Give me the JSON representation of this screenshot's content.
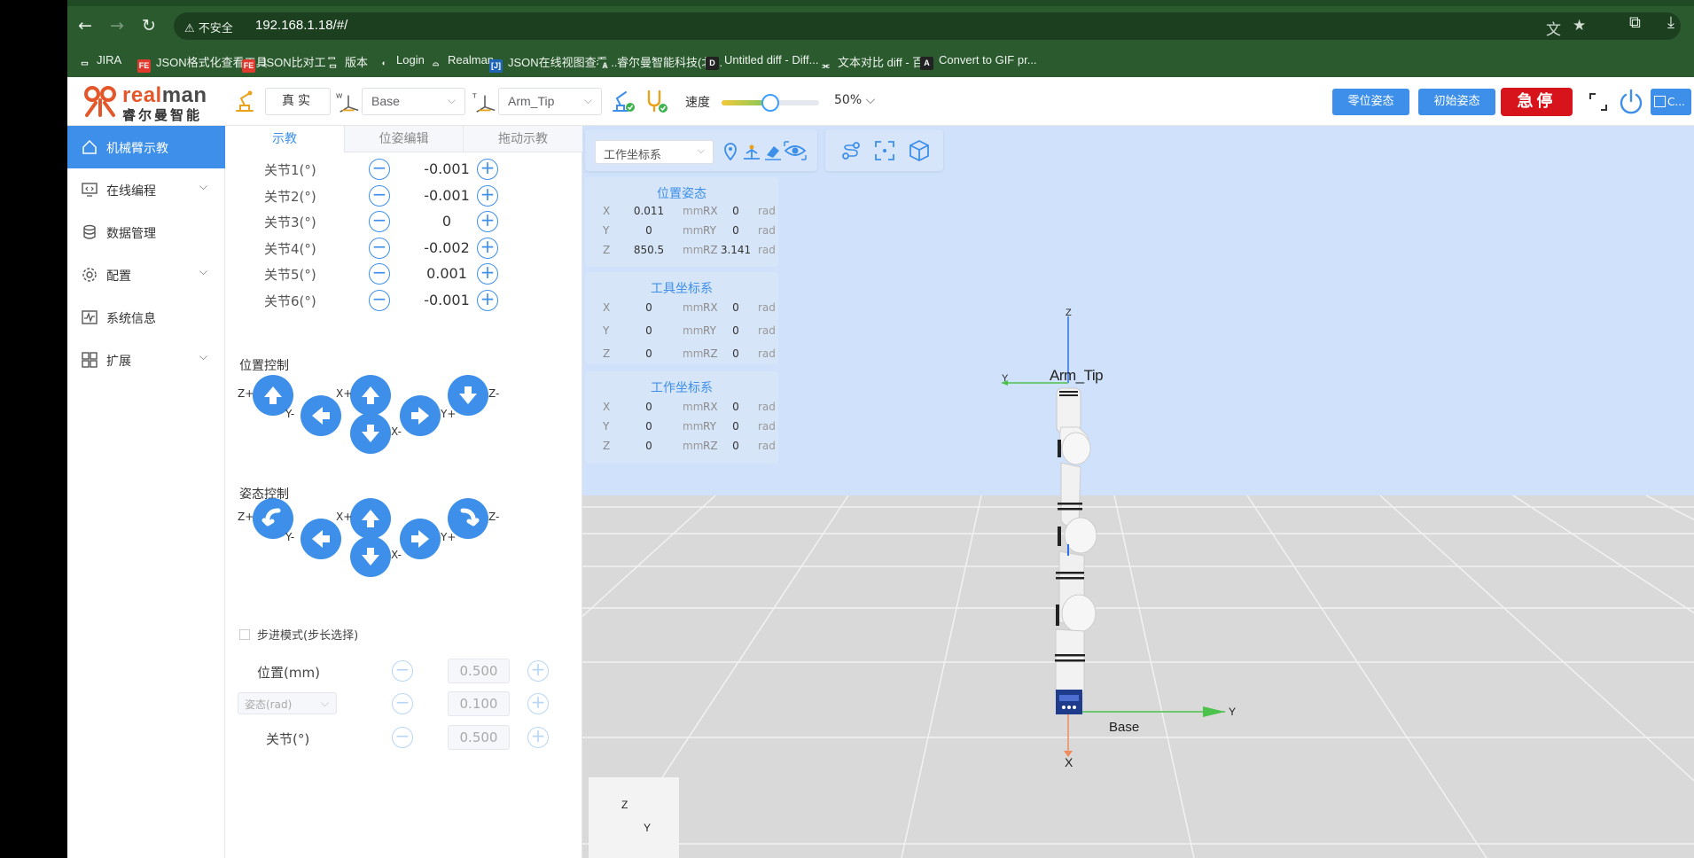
{
  "browser": {
    "security_label": "不安全",
    "url": "192.168.1.18/#/",
    "bookmarks": [
      "JIRA",
      "JSON格式化查看工具",
      "JSON比对工具",
      "版本",
      "Login",
      "Realman",
      "JSON在线视图查看...",
      "睿尔曼智能科技(北...",
      "Untitled diff - Diff...",
      "文本对比 diff - 百...",
      "Convert to GIF pr..."
    ]
  },
  "logo": {
    "en_prefix": "real",
    "en_suffix": "man",
    "cn": "睿尔曼智能"
  },
  "topbar": {
    "mode_button": "真实",
    "frame_select": "Base",
    "tool_select": "Arm_Tip",
    "speed_label": "速度",
    "speed_value": "50%",
    "speed_fraction": 0.5,
    "zero_pose": "零位姿态",
    "init_pose": "初始姿态",
    "estop": "急停",
    "connect_label": "C..."
  },
  "sidebar": {
    "items": [
      {
        "label": "机械臂示教",
        "icon": "home-icon"
      },
      {
        "label": "在线编程",
        "icon": "monitor-code-icon"
      },
      {
        "label": "数据管理",
        "icon": "database-icon"
      },
      {
        "label": "配置",
        "icon": "settings-icon"
      },
      {
        "label": "系统信息",
        "icon": "pulse-icon"
      },
      {
        "label": "扩展",
        "icon": "apps-icon"
      }
    ]
  },
  "tabs": [
    "示教",
    "位姿编辑",
    "拖动示教"
  ],
  "joints": [
    {
      "label": "关节1(°)",
      "value": "-0.001"
    },
    {
      "label": "关节2(°)",
      "value": "-0.001"
    },
    {
      "label": "关节3(°)",
      "value": "0"
    },
    {
      "label": "关节4(°)",
      "value": "-0.002"
    },
    {
      "label": "关节5(°)",
      "value": "0.001"
    },
    {
      "label": "关节6(°)",
      "value": "-0.001"
    }
  ],
  "position_control": {
    "title": "位置控制",
    "labels": {
      "zp": "Z+",
      "ym": "Y-",
      "xp": "X+",
      "xm": "X-",
      "yp": "Y+",
      "zm": "Z-"
    }
  },
  "pose_control": {
    "title": "姿态控制",
    "labels": {
      "zp": "Z+",
      "ym": "Y-",
      "xp": "X+",
      "xm": "X-",
      "yp": "Y+",
      "zm": "Z-"
    }
  },
  "step": {
    "mode_label": "步进模式(步长选择)",
    "position_label": "位置(mm)",
    "position_value": "0.500",
    "pose_select": "姿态(rad)",
    "pose_value": "0.100",
    "joint_label": "关节(°)",
    "joint_value": "0.500"
  },
  "viewport": {
    "frame_select": "工作坐标系",
    "cards": [
      {
        "title": "位置姿态",
        "rows": [
          {
            "k": "X",
            "v": "0.011",
            "u": "mm",
            "rk": "RX",
            "rv": "0",
            "ru": "rad"
          },
          {
            "k": "Y",
            "v": "0",
            "u": "mm",
            "rk": "RY",
            "rv": "0",
            "ru": "rad"
          },
          {
            "k": "Z",
            "v": "850.5",
            "u": "mm",
            "rk": "RZ",
            "rv": "3.141",
            "ru": "rad"
          }
        ]
      },
      {
        "title": "工具坐标系",
        "rows": [
          {
            "k": "X",
            "v": "0",
            "u": "mm",
            "rk": "RX",
            "rv": "0",
            "ru": "rad"
          },
          {
            "k": "Y",
            "v": "0",
            "u": "mm",
            "rk": "RY",
            "rv": "0",
            "ru": "rad"
          },
          {
            "k": "Z",
            "v": "0",
            "u": "mm",
            "rk": "RZ",
            "rv": "0",
            "ru": "rad"
          }
        ]
      },
      {
        "title": "工作坐标系",
        "rows": [
          {
            "k": "X",
            "v": "0",
            "u": "mm",
            "rk": "RX",
            "rv": "0",
            "ru": "rad"
          },
          {
            "k": "Y",
            "v": "0",
            "u": "mm",
            "rk": "RY",
            "rv": "0",
            "ru": "rad"
          },
          {
            "k": "Z",
            "v": "0",
            "u": "mm",
            "rk": "RZ",
            "rv": "0",
            "ru": "rad"
          }
        ]
      }
    ],
    "labels": {
      "tip": "Arm_Tip",
      "base": "Base",
      "z": "Z",
      "y": "Y",
      "x": "X"
    }
  },
  "colors": {
    "accent": "#3d8fe9",
    "estop": "#d7131b",
    "sky": "#cfe1fb",
    "floor": "#d9d9d9"
  }
}
